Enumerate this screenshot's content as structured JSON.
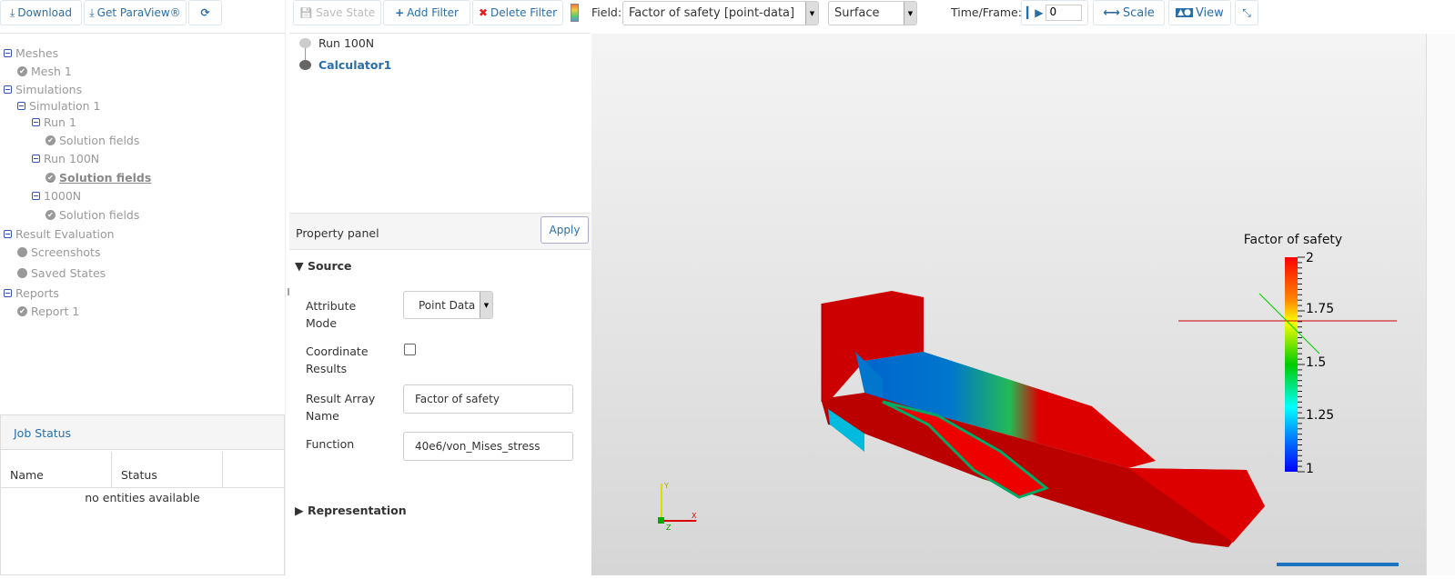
{
  "left_toolbar": {
    "download": "Download",
    "get_paraview": "Get ParaView®"
  },
  "tree": {
    "meshes": "Meshes",
    "mesh1": "Mesh 1",
    "simulations": "Simulations",
    "simulation1": "Simulation 1",
    "run1": "Run 1",
    "run1_fields": "Solution fields",
    "run100n": "Run 100N",
    "run100n_fields": "Solution fields",
    "run1000n": "1000N",
    "run1000n_fields": "Solution fields",
    "result_evaluation": "Result Evaluation",
    "screenshots": "Screenshots",
    "saved_states": "Saved States",
    "reports": "Reports",
    "report1": "Report 1"
  },
  "job_status": {
    "title": "Job Status",
    "columns": [
      "Name",
      "Status",
      ""
    ],
    "empty": "no entities available"
  },
  "pipeline_toolbar": {
    "save_state": "Save State",
    "add_filter": "Add Filter",
    "delete_filter": "Delete Filter"
  },
  "pipeline": {
    "items": [
      "Run 100N",
      "Calculator1"
    ]
  },
  "property_panel": {
    "title": "Property panel",
    "apply": "Apply",
    "source": "Source",
    "attribute_mode_label": "Attribute Mode",
    "attribute_mode_value": "Point Data",
    "coordinate_results_label": "Coordinate Results",
    "coordinate_results_checked": false,
    "result_array_label": "Result Array Name",
    "result_array_value": "Factor of safety",
    "function_label": "Function",
    "function_value": "40e6/von_Mises_stress",
    "representation": "Representation"
  },
  "view_toolbar": {
    "field_label": "Field:",
    "field_value": "Factor of safety [point-data]",
    "representation_value": "Surface",
    "time_label": "Time/Frame:",
    "time_value": "0",
    "scale": "Scale",
    "view": "View"
  },
  "legend": {
    "title": "Factor of safety",
    "ticks": [
      "2",
      "1.75",
      "1.5",
      "1.25",
      "1"
    ],
    "min": 1,
    "max": 2
  },
  "axes": {
    "x": "X",
    "y": "Y",
    "z": "Z"
  }
}
